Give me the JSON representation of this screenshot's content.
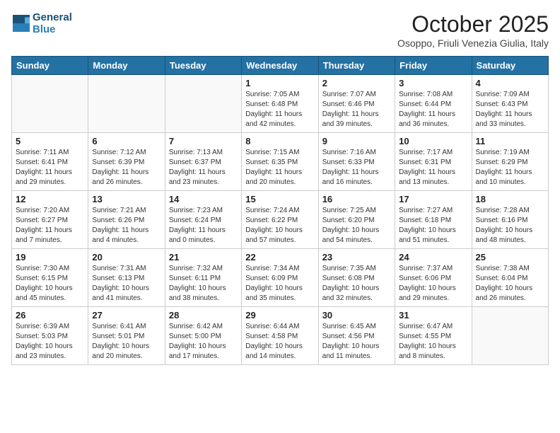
{
  "header": {
    "logo_line1": "General",
    "logo_line2": "Blue",
    "month_title": "October 2025",
    "location": "Osoppo, Friuli Venezia Giulia, Italy"
  },
  "weekdays": [
    "Sunday",
    "Monday",
    "Tuesday",
    "Wednesday",
    "Thursday",
    "Friday",
    "Saturday"
  ],
  "weeks": [
    [
      {
        "day": "",
        "info": ""
      },
      {
        "day": "",
        "info": ""
      },
      {
        "day": "",
        "info": ""
      },
      {
        "day": "1",
        "info": "Sunrise: 7:05 AM\nSunset: 6:48 PM\nDaylight: 11 hours and 42 minutes."
      },
      {
        "day": "2",
        "info": "Sunrise: 7:07 AM\nSunset: 6:46 PM\nDaylight: 11 hours and 39 minutes."
      },
      {
        "day": "3",
        "info": "Sunrise: 7:08 AM\nSunset: 6:44 PM\nDaylight: 11 hours and 36 minutes."
      },
      {
        "day": "4",
        "info": "Sunrise: 7:09 AM\nSunset: 6:43 PM\nDaylight: 11 hours and 33 minutes."
      }
    ],
    [
      {
        "day": "5",
        "info": "Sunrise: 7:11 AM\nSunset: 6:41 PM\nDaylight: 11 hours and 29 minutes."
      },
      {
        "day": "6",
        "info": "Sunrise: 7:12 AM\nSunset: 6:39 PM\nDaylight: 11 hours and 26 minutes."
      },
      {
        "day": "7",
        "info": "Sunrise: 7:13 AM\nSunset: 6:37 PM\nDaylight: 11 hours and 23 minutes."
      },
      {
        "day": "8",
        "info": "Sunrise: 7:15 AM\nSunset: 6:35 PM\nDaylight: 11 hours and 20 minutes."
      },
      {
        "day": "9",
        "info": "Sunrise: 7:16 AM\nSunset: 6:33 PM\nDaylight: 11 hours and 16 minutes."
      },
      {
        "day": "10",
        "info": "Sunrise: 7:17 AM\nSunset: 6:31 PM\nDaylight: 11 hours and 13 minutes."
      },
      {
        "day": "11",
        "info": "Sunrise: 7:19 AM\nSunset: 6:29 PM\nDaylight: 11 hours and 10 minutes."
      }
    ],
    [
      {
        "day": "12",
        "info": "Sunrise: 7:20 AM\nSunset: 6:27 PM\nDaylight: 11 hours and 7 minutes."
      },
      {
        "day": "13",
        "info": "Sunrise: 7:21 AM\nSunset: 6:26 PM\nDaylight: 11 hours and 4 minutes."
      },
      {
        "day": "14",
        "info": "Sunrise: 7:23 AM\nSunset: 6:24 PM\nDaylight: 11 hours and 0 minutes."
      },
      {
        "day": "15",
        "info": "Sunrise: 7:24 AM\nSunset: 6:22 PM\nDaylight: 10 hours and 57 minutes."
      },
      {
        "day": "16",
        "info": "Sunrise: 7:25 AM\nSunset: 6:20 PM\nDaylight: 10 hours and 54 minutes."
      },
      {
        "day": "17",
        "info": "Sunrise: 7:27 AM\nSunset: 6:18 PM\nDaylight: 10 hours and 51 minutes."
      },
      {
        "day": "18",
        "info": "Sunrise: 7:28 AM\nSunset: 6:16 PM\nDaylight: 10 hours and 48 minutes."
      }
    ],
    [
      {
        "day": "19",
        "info": "Sunrise: 7:30 AM\nSunset: 6:15 PM\nDaylight: 10 hours and 45 minutes."
      },
      {
        "day": "20",
        "info": "Sunrise: 7:31 AM\nSunset: 6:13 PM\nDaylight: 10 hours and 41 minutes."
      },
      {
        "day": "21",
        "info": "Sunrise: 7:32 AM\nSunset: 6:11 PM\nDaylight: 10 hours and 38 minutes."
      },
      {
        "day": "22",
        "info": "Sunrise: 7:34 AM\nSunset: 6:09 PM\nDaylight: 10 hours and 35 minutes."
      },
      {
        "day": "23",
        "info": "Sunrise: 7:35 AM\nSunset: 6:08 PM\nDaylight: 10 hours and 32 minutes."
      },
      {
        "day": "24",
        "info": "Sunrise: 7:37 AM\nSunset: 6:06 PM\nDaylight: 10 hours and 29 minutes."
      },
      {
        "day": "25",
        "info": "Sunrise: 7:38 AM\nSunset: 6:04 PM\nDaylight: 10 hours and 26 minutes."
      }
    ],
    [
      {
        "day": "26",
        "info": "Sunrise: 6:39 AM\nSunset: 5:03 PM\nDaylight: 10 hours and 23 minutes."
      },
      {
        "day": "27",
        "info": "Sunrise: 6:41 AM\nSunset: 5:01 PM\nDaylight: 10 hours and 20 minutes."
      },
      {
        "day": "28",
        "info": "Sunrise: 6:42 AM\nSunset: 5:00 PM\nDaylight: 10 hours and 17 minutes."
      },
      {
        "day": "29",
        "info": "Sunrise: 6:44 AM\nSunset: 4:58 PM\nDaylight: 10 hours and 14 minutes."
      },
      {
        "day": "30",
        "info": "Sunrise: 6:45 AM\nSunset: 4:56 PM\nDaylight: 10 hours and 11 minutes."
      },
      {
        "day": "31",
        "info": "Sunrise: 6:47 AM\nSunset: 4:55 PM\nDaylight: 10 hours and 8 minutes."
      },
      {
        "day": "",
        "info": ""
      }
    ]
  ]
}
